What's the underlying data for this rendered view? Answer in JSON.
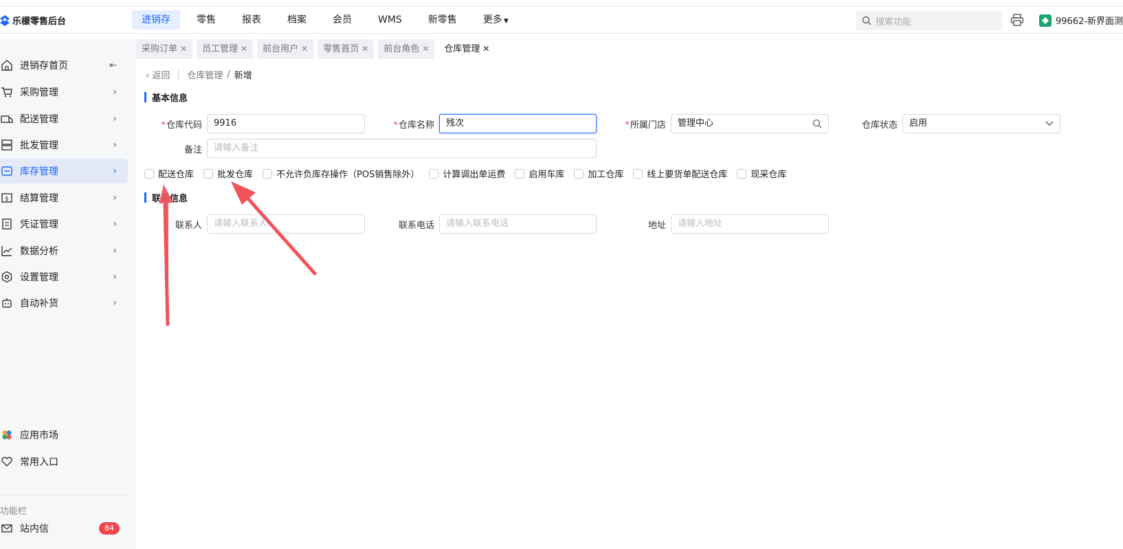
{
  "topbar": {
    "brand": "乐檬零售后台",
    "nav": [
      {
        "label": "进销存",
        "active": true
      },
      {
        "label": "零售"
      },
      {
        "label": "报表"
      },
      {
        "label": "档案"
      },
      {
        "label": "会员"
      },
      {
        "label": "WMS"
      },
      {
        "label": "新零售"
      },
      {
        "label": "更多"
      }
    ],
    "search_placeholder": "搜索功能",
    "store": "99662-新界面测"
  },
  "sidebar": {
    "items": [
      {
        "label": "进销存首页",
        "icon": "home-icon"
      },
      {
        "label": "采购管理",
        "icon": "cart-icon"
      },
      {
        "label": "配送管理",
        "icon": "truck-icon"
      },
      {
        "label": "批发管理",
        "icon": "server-icon"
      },
      {
        "label": "库存管理",
        "icon": "inventory-icon",
        "active": true
      },
      {
        "label": "结算管理",
        "icon": "money-icon"
      },
      {
        "label": "凭证管理",
        "icon": "voucher-icon"
      },
      {
        "label": "数据分析",
        "icon": "chart-icon"
      },
      {
        "label": "设置管理",
        "icon": "settings-icon"
      },
      {
        "label": "自动补货",
        "icon": "robot-icon"
      }
    ],
    "app_market": "应用市场",
    "favorites": "常用入口",
    "section_label": "功能栏",
    "inbox": "站内信",
    "inbox_count": "84"
  },
  "tabs": [
    {
      "label": "采购订单"
    },
    {
      "label": "员工管理"
    },
    {
      "label": "前台用户"
    },
    {
      "label": "零售首页"
    },
    {
      "label": "前台角色"
    },
    {
      "label": "仓库管理",
      "active": true
    }
  ],
  "breadcrumb": {
    "back": "返回",
    "parent": "仓库管理",
    "separator": "/",
    "current": "新增"
  },
  "basic": {
    "title": "基本信息",
    "code_label": "仓库代码",
    "code_value": "9916",
    "name_label": "仓库名称",
    "name_value": "残次",
    "store_label": "所属门店",
    "store_value": "管理中心",
    "status_label": "仓库状态",
    "status_value": "启用",
    "remark_label": "备注",
    "remark_placeholder": "请输入备注"
  },
  "checkboxes": [
    "配送仓库",
    "批发仓库",
    "不允许负库存操作（POS销售除外）",
    "计算调出单运费",
    "启用车库",
    "加工仓库",
    "线上要货单配送仓库",
    "现采仓库"
  ],
  "contact": {
    "title": "联系信息",
    "person_label": "联系人",
    "person_placeholder": "请输入联系人",
    "phone_label": "联系电话",
    "phone_placeholder": "请输入联系电话",
    "address_label": "地址",
    "address_placeholder": "请输入地址"
  },
  "colors": {
    "accent": "#1a66ff",
    "required": "#f0474d",
    "annotation_arrow": "#f0535a"
  }
}
